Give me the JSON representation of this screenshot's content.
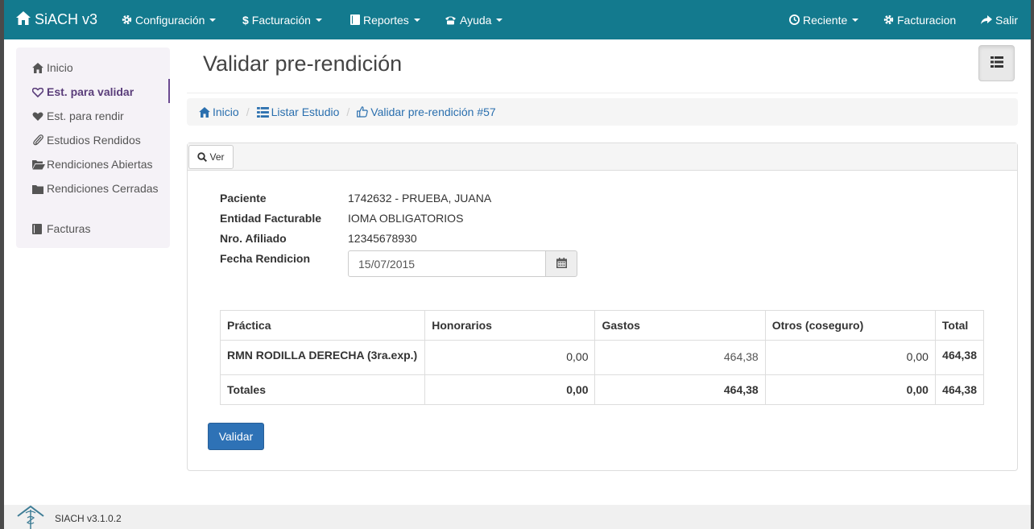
{
  "navbar": {
    "brand": "SiACH v3",
    "left_items": [
      {
        "label": "Configuración",
        "icon": "gear-icon"
      },
      {
        "label": "Facturación",
        "icon": "dollar-icon"
      },
      {
        "label": "Reportes",
        "icon": "book-icon"
      },
      {
        "label": "Ayuda",
        "icon": "phone-icon"
      }
    ],
    "right_items": [
      {
        "label": "Reciente",
        "icon": "clock-icon"
      },
      {
        "label": "Facturacion",
        "icon": "gear-icon"
      },
      {
        "label": "Salir",
        "icon": "share-icon"
      }
    ]
  },
  "sidebar": {
    "items": [
      {
        "label": "Inicio",
        "icon": "home-icon"
      },
      {
        "label": "Est. para validar",
        "icon": "heart-outline-icon",
        "active": true
      },
      {
        "label": "Est. para rendir",
        "icon": "heart-icon"
      },
      {
        "label": "Estudios Rendidos",
        "icon": "paperclip-icon"
      },
      {
        "label": "Rendiciones Abiertas",
        "icon": "folder-open-icon"
      },
      {
        "label": "Rendiciones Cerradas",
        "icon": "folder-icon"
      },
      {
        "label": "Facturas",
        "icon": "book-icon"
      }
    ]
  },
  "page": {
    "title": "Validar pre-rendición"
  },
  "breadcrumb": [
    {
      "label": "Inicio",
      "icon": "home-icon"
    },
    {
      "label": "Listar Estudio",
      "icon": "list-icon"
    },
    {
      "label": "Validar pre-rendición #57",
      "icon": "thumbs-up-icon"
    }
  ],
  "panel": {
    "tab_label": "Ver",
    "fields": [
      {
        "label": "Paciente",
        "value": "1742632 - PRUEBA, JUANA"
      },
      {
        "label": "Entidad Facturable",
        "value": "IOMA OBLIGATORIOS"
      },
      {
        "label": "Nro. Afiliado",
        "value": "12345678930"
      },
      {
        "label": "Fecha Rendicion",
        "value": "15/07/2015"
      }
    ],
    "table": {
      "headers": [
        "Práctica",
        "Honorarios",
        "Gastos",
        "Otros (coseguro)",
        "Total"
      ],
      "rows": [
        [
          "RMN RODILLA DERECHA (3ra.exp.)",
          "0,00",
          "464,38",
          "0,00",
          "464,38"
        ]
      ],
      "totals": [
        "Totales",
        "0,00",
        "464,38",
        "0,00",
        "464,38"
      ]
    },
    "validate_label": "Validar"
  },
  "footer": {
    "version": "SIACH v3.1.0.2"
  },
  "colors": {
    "navbar": "#137a8e",
    "primary_button": "#2e72b6",
    "link": "#2a6fae",
    "sidebar_active": "#5a3d7a"
  }
}
